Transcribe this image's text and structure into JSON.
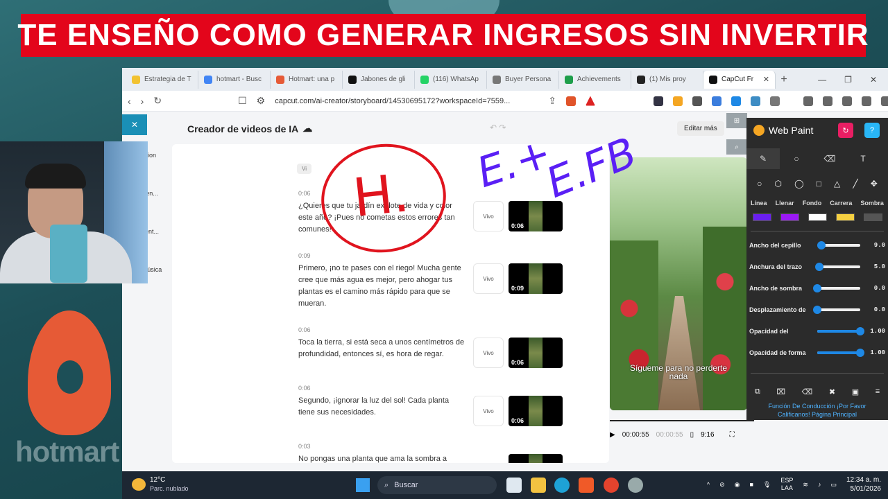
{
  "banner": {
    "text": "TE ENSEÑO COMO GENERAR INGRESOS SIN INVERTIR"
  },
  "browser": {
    "tabs": [
      {
        "label": "Estrategia de T",
        "color": "#f2c230"
      },
      {
        "label": "hotmart - Busc",
        "color": "#4285f4"
      },
      {
        "label": "Hotmart: una p",
        "color": "#e65a36"
      },
      {
        "label": "Jabones de gli",
        "color": "#111111"
      },
      {
        "label": "(116) WhatsAp",
        "color": "#25d366"
      },
      {
        "label": "Buyer Persona",
        "color": "#777777"
      },
      {
        "label": "Achievements",
        "color": "#1e9e4a"
      },
      {
        "label": "(1)  Mis proy",
        "color": "#222222"
      },
      {
        "label": "CapCut Fr",
        "color": "#111111",
        "active": true
      }
    ],
    "url": "capcut.com/ai-creator/storyboard/14530695172?workspaceId=7559...",
    "new_tab": "+",
    "close_tab": "✕"
  },
  "app": {
    "title": "Creador de videos de IA",
    "edit_more": "Editar más",
    "close": "✕",
    "sidebar": [
      {
        "label": "ion"
      },
      {
        "label": "en..."
      },
      {
        "label": "ent..."
      },
      {
        "label": "Música"
      }
    ],
    "voice_chip": "Vi",
    "segments": [
      {
        "time": "0:06",
        "text": "¿Quieres que tu jardín explote de vida y color este año? ¡Pues no cometas estos errores tan comunes!",
        "vivo": "Vivo",
        "duration": "0:06"
      },
      {
        "time": "0:09",
        "text": "Primero, ¡no te pases con el riego! Mucha gente cree que más agua es mejor, pero ahogar tus plantas es el camino más rápido para que se mueran.",
        "vivo": "Vivo",
        "duration": "0:09"
      },
      {
        "time": "0:06",
        "text": "Toca la tierra, si está seca a unos centímetros de profundidad, entonces sí, es hora de regar.",
        "vivo": "Vivo",
        "duration": "0:06"
      },
      {
        "time": "0:06",
        "text": "Segundo, ¡ignorar la luz del sol! Cada planta tiene sus necesidades.",
        "vivo": "Vivo",
        "duration": "0:06"
      },
      {
        "time": "0:03",
        "text": "No pongas una planta que ama la sombra a",
        "vivo": "",
        "duration": ""
      }
    ],
    "preview": {
      "caption_line1": "Sígueme para no perderte",
      "caption_line2": "nada",
      "current_time": "00:00:55",
      "total_time": "00:00:55",
      "aspect": "9:16"
    }
  },
  "webpaint": {
    "title": "Web Paint",
    "tabs": [
      "✎",
      "○",
      "⌫",
      "T"
    ],
    "shapes": [
      "○",
      "⬡",
      "◯",
      "□",
      "△",
      "╱",
      "✥"
    ],
    "color_labels": [
      "Línea",
      "Llenar",
      "Fondo",
      "Carrera",
      "Sombra"
    ],
    "swatches": [
      "#6a1ff0",
      "#9b19f5",
      "#ffffff",
      "#f5d041",
      "#555555"
    ],
    "sliders": [
      {
        "label": "Ancho del cepillo",
        "value": "9.0",
        "level": 0.1
      },
      {
        "label": "Anchura del trazo",
        "value": "5.0",
        "level": 0.05
      },
      {
        "label": "Ancho de sombra",
        "value": "0.0",
        "level": 0
      },
      {
        "label": "Desplazamiento de",
        "value": "0.0",
        "level": 0
      },
      {
        "label": "Opacidad del",
        "value": "1.00",
        "level": 1
      },
      {
        "label": "Opacidad de forma",
        "value": "1.00",
        "level": 1
      }
    ],
    "tools": [
      "⧉",
      "🗑",
      "⌫",
      "🗑",
      "💾",
      "≡"
    ],
    "links_line1": "Función De Conducción  ¡Por Favor",
    "links_line2": "Calificanos!  Página Principal"
  },
  "annotations": {
    "circle_letter": "H.",
    "note1": "E.+",
    "note2": "E.FB"
  },
  "hotmart": {
    "text": "hotmart"
  },
  "taskbar": {
    "temp": "12°C",
    "weather": "Parc. nublado",
    "search": "Buscar",
    "lang_line1": "ESP",
    "lang_line2": "LAA",
    "time": "12:34 a. m.",
    "date": "5/01/2026"
  }
}
